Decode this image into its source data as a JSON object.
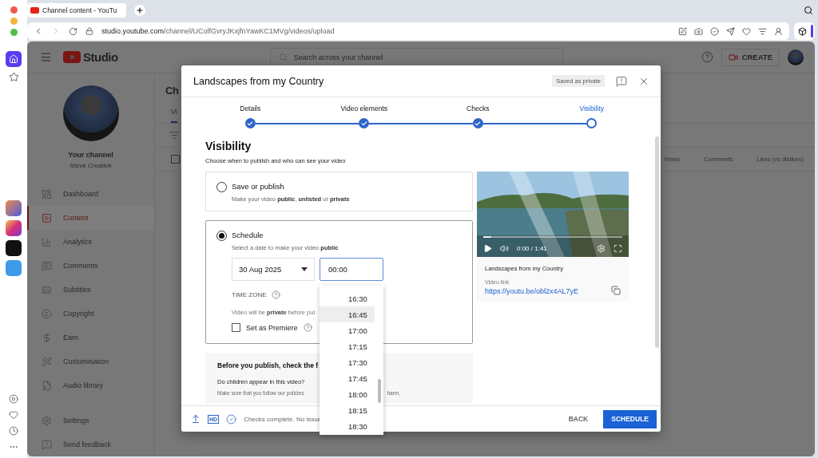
{
  "browser": {
    "tab_title": "Channel content - YouTu",
    "url_host": "studio.youtube.com",
    "url_path": "/channel/UColfGvryJKxjfnYawKC1MVg/videos/upload"
  },
  "studio": {
    "logo": "Studio",
    "search_placeholder": "Search across your channel",
    "create": "CREATE",
    "channel_title": "Your channel",
    "channel_name": "Steve Creative",
    "nav": [
      {
        "label": "Dashboard",
        "selected": false
      },
      {
        "label": "Content",
        "selected": true
      },
      {
        "label": "Analytics",
        "selected": false
      },
      {
        "label": "Comments",
        "selected": false
      },
      {
        "label": "Subtitles",
        "selected": false
      },
      {
        "label": "Copyright",
        "selected": false
      },
      {
        "label": "Earn",
        "selected": false
      },
      {
        "label": "Customisation",
        "selected": false
      },
      {
        "label": "Audio library",
        "selected": false
      }
    ],
    "footer_nav": [
      {
        "label": "Settings"
      },
      {
        "label": "Send feedback"
      }
    ],
    "page_title": "Ch",
    "select_all": {
      "checked": false
    },
    "tabs": [
      {
        "label": "Vi",
        "selected": true
      }
    ],
    "columns": [
      "Views",
      "Comments",
      "Likes (vs dislikes)"
    ]
  },
  "dialog": {
    "title": "Landscapes from my Country",
    "badge": "Saved as private",
    "steps": [
      {
        "label": "Details",
        "done": true,
        "selected": false
      },
      {
        "label": "Video elements",
        "done": true,
        "selected": false
      },
      {
        "label": "Checks",
        "done": true,
        "selected": false
      },
      {
        "label": "Visibility",
        "done": false,
        "selected": true
      }
    ],
    "heading": "Visibility",
    "subheading": "Choose when to publish and who can see your video",
    "options": [
      {
        "kind": "save",
        "title": "Save or publish",
        "description": "Make your video **public**, **unlisted** or **private**",
        "selected": false
      },
      {
        "kind": "schedule",
        "title": "Schedule",
        "description": "Select a date to make your video **public**",
        "selected": true
      }
    ],
    "schedule": {
      "date": "30 Aug 2025",
      "time": "00:00",
      "time_zone_label": "TIME ZONE",
      "private_note": "Video will be **private** before pul",
      "premiere": {
        "label": "Set as Premiere",
        "checked": false
      }
    },
    "checklist": {
      "heading": "Before you publish, check the f",
      "question": "Do children appear in this video?",
      "note": "Make sure that you follow our policies",
      "note_end": "harm,"
    },
    "preview": {
      "title": "Landscapes from my Country",
      "elapsed": "0:00 / 1:41",
      "level": 0.06,
      "link_label": "Video link",
      "link": "https://youtu.be/obl2x4AL7yE"
    },
    "time_options": [
      {
        "label": "16:30",
        "selected": false
      },
      {
        "label": "16:45",
        "selected": true
      },
      {
        "label": "17:00",
        "selected": false
      },
      {
        "label": "17:15",
        "selected": false
      },
      {
        "label": "17:30",
        "selected": false
      },
      {
        "label": "17:45",
        "selected": false
      },
      {
        "label": "18:00",
        "selected": false
      },
      {
        "label": "18:15",
        "selected": false
      },
      {
        "label": "18:30",
        "selected": false
      }
    ],
    "footer": {
      "hd": "HD",
      "status": "Checks complete. No issue",
      "back": "BACK",
      "primary": "SCHEDULE"
    }
  }
}
